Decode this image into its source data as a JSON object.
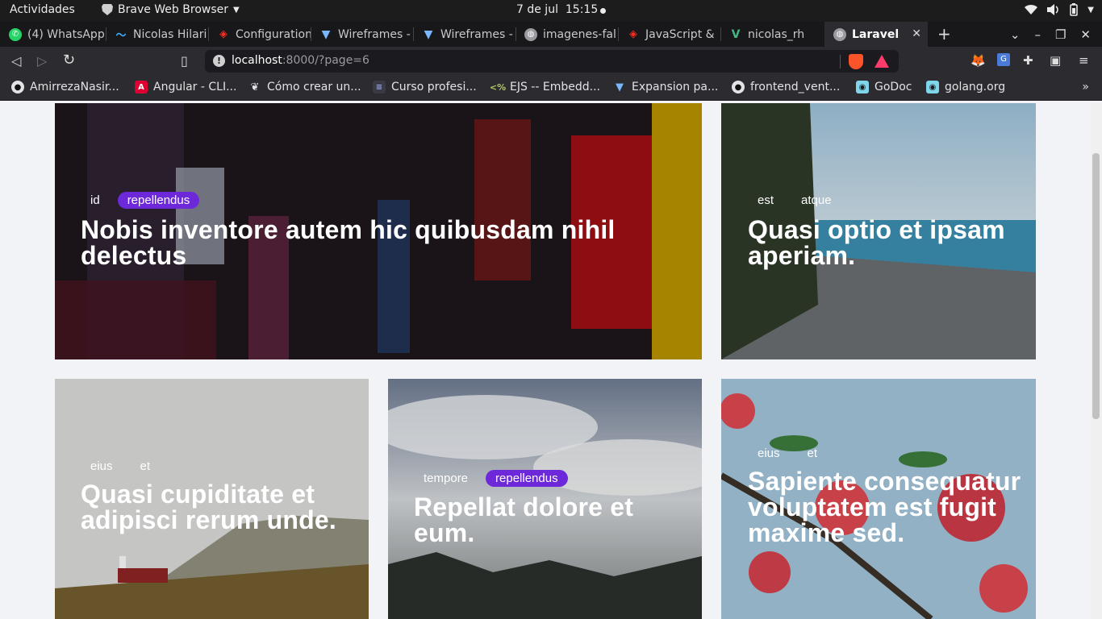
{
  "os_bar": {
    "activities": "Actividades",
    "app_name": "Brave Web Browser",
    "date": "7 de jul",
    "time": "15:15"
  },
  "tabs": [
    {
      "label": "(4) WhatsApp",
      "icon": "whatsapp-icon"
    },
    {
      "label": "Nicolas Hilari",
      "icon": "wave-icon"
    },
    {
      "label": "Configuration",
      "icon": "laravel-icon"
    },
    {
      "label": "Wireframes -",
      "icon": "vuetify-icon"
    },
    {
      "label": "Wireframes -",
      "icon": "vuetify-icon"
    },
    {
      "label": "imagenes-fal",
      "icon": "globe-icon"
    },
    {
      "label": "JavaScript &",
      "icon": "laravel-icon"
    },
    {
      "label": "nicolas_rh",
      "icon": "vue-icon"
    },
    {
      "label": "Laravel",
      "icon": "globe-icon",
      "active": true
    }
  ],
  "address": {
    "host": "localhost",
    "rest": ":8000/?page=6"
  },
  "bookmarks": [
    {
      "label": "AmirrezaNasir...",
      "icon": "github-icon"
    },
    {
      "label": "Angular - CLI...",
      "icon": "angular-icon"
    },
    {
      "label": "Cómo crear un...",
      "icon": "leaf-icon"
    },
    {
      "label": "Curso profesi...",
      "icon": "course-icon"
    },
    {
      "label": "EJS -- Embedd...",
      "icon": "ejs-icon"
    },
    {
      "label": "Expansion pa...",
      "icon": "vuetify-icon"
    },
    {
      "label": "frontend_vent...",
      "icon": "github-icon"
    },
    {
      "label": "GoDoc",
      "icon": "gopher-icon"
    },
    {
      "label": "golang.org",
      "icon": "gopher-icon"
    }
  ],
  "cards": [
    {
      "tags": [
        "id",
        "repellendus"
      ],
      "highlight": 1,
      "title": "Nobis inventore autem hic quibusdam nihil delectus"
    },
    {
      "tags": [
        "est",
        "atque"
      ],
      "highlight": -1,
      "title": "Quasi optio et ipsam aperiam."
    },
    {
      "tags": [
        "eius",
        "et"
      ],
      "highlight": -1,
      "title": "Quasi cupiditate et adipisci rerum unde."
    },
    {
      "tags": [
        "tempore",
        "repellendus"
      ],
      "highlight": 1,
      "title": "Repellat dolore et eum."
    },
    {
      "tags": [
        "eius",
        "et"
      ],
      "highlight": -1,
      "title": "Sapiente consequatur voluptatem est fugit maxime sed."
    }
  ],
  "colors": {
    "tag_highlight": "#6d28d9",
    "page_bg": "#f2f3f6"
  }
}
